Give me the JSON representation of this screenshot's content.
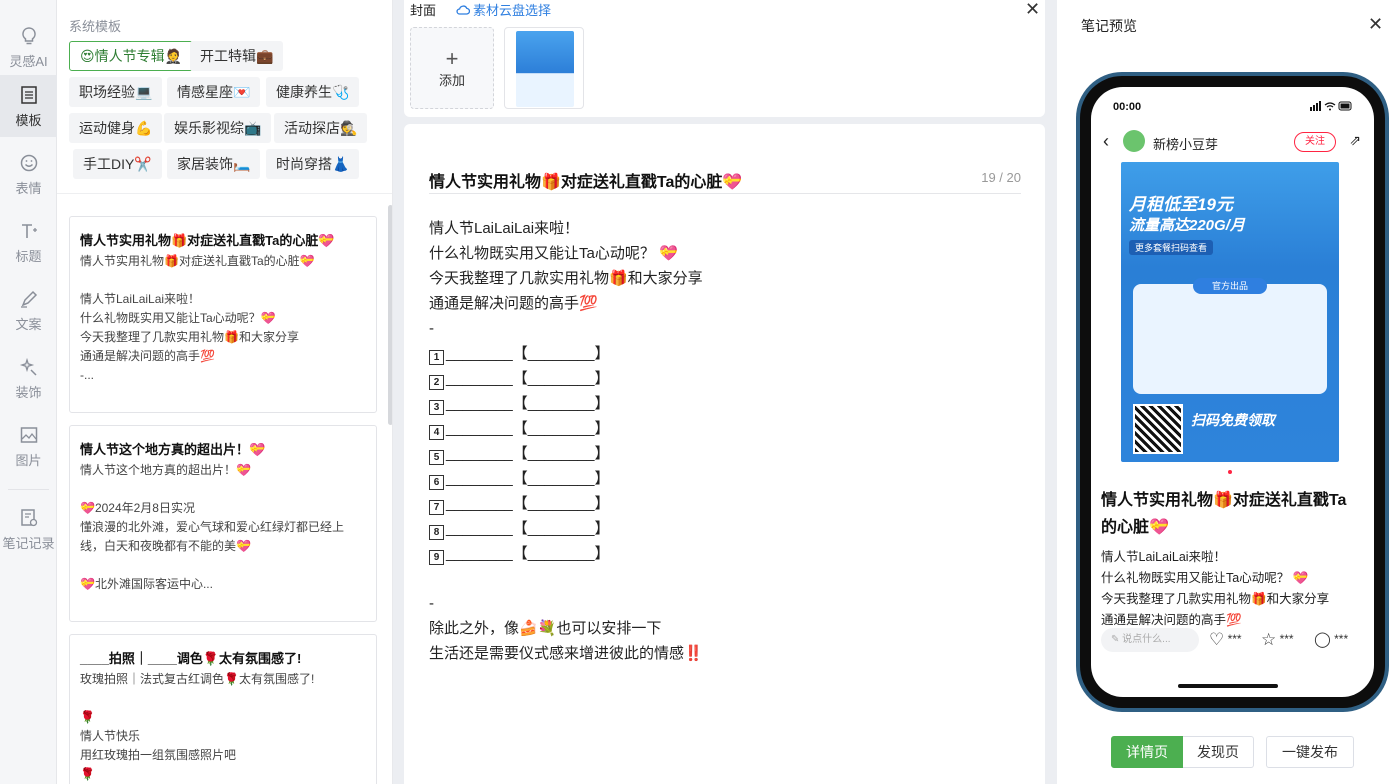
{
  "nav": [
    {
      "label": "灵感AI",
      "icon": "lightbulb-icon"
    },
    {
      "label": "模板",
      "icon": "template-icon",
      "active": true
    },
    {
      "label": "表情",
      "icon": "smiley-icon"
    },
    {
      "label": "标题",
      "icon": "title-icon"
    },
    {
      "label": "文案",
      "icon": "pen-icon"
    },
    {
      "label": "装饰",
      "icon": "sparkle-icon"
    },
    {
      "label": "图片",
      "icon": "image-icon"
    },
    {
      "label": "笔记记录",
      "icon": "note-record-icon"
    }
  ],
  "templates": {
    "section_title": "系统模板",
    "chips": [
      {
        "label": "😍情人节专辑🤵",
        "active": true
      },
      {
        "label": "开工特辑💼"
      },
      {
        "label": "职场经验💻"
      },
      {
        "label": "情感星座💌"
      },
      {
        "label": "健康养生🩺"
      },
      {
        "label": "运动健身💪"
      },
      {
        "label": "娱乐影视综📺"
      },
      {
        "label": "活动探店🕵️"
      },
      {
        "label": "手工DIY✂️"
      },
      {
        "label": "家居装饰🛏️"
      },
      {
        "label": "时尚穿搭👗"
      }
    ],
    "cards": [
      {
        "title": "情人节实用礼物🎁对症送礼直戳Ta的心脏💝",
        "lines": [
          "情人节实用礼物🎁对症送礼直戳Ta的心脏💝",
          "",
          "情人节LaiLaiLai来啦！",
          "什么礼物既实用又能让Ta心动呢？💝",
          "今天我整理了几款实用礼物🎁和大家分享",
          "通通是解决问题的高手💯",
          "-..."
        ]
      },
      {
        "title": "情人节这个地方真的超出片！💝",
        "lines": [
          "情人节这个地方真的超出片！💝",
          "",
          "💝2024年2月8日实况",
          "懂浪漫的北外滩，爱心气球和爱心红绿灯都已经上",
          "线，白天和夜晚都有不能的美💝",
          "",
          "💝北外滩国际客运中心..."
        ]
      },
      {
        "title": "____拍照｜____调色🌹太有氛围感了!",
        "lines": [
          "玫瑰拍照｜法式复古红调色🌹太有氛围感了!",
          "",
          "🌹",
          "情人节快乐",
          "用红玫瑰拍一组氛围感照片吧",
          "🌹"
        ]
      }
    ]
  },
  "cover": {
    "label": "封面",
    "cloud_link": "素材云盘选择",
    "add_label": "添加"
  },
  "editor": {
    "title": "情人节实用礼物🎁对症送礼直戳Ta的心脏💝",
    "count": "19 / 20",
    "lines": [
      "情人节LaiLaiLai来啦！",
      "什么礼物既实用又能让Ta心动呢？ 💝",
      "今天我整理了几款实用礼物🎁和大家分享",
      "通通是解决问题的高手💯",
      "-"
    ],
    "list_items": [
      {
        "num": "1",
        "text": "________【________】"
      },
      {
        "num": "2",
        "text": "________【________】"
      },
      {
        "num": "3",
        "text": "________【________】"
      },
      {
        "num": "4",
        "text": "________【________】"
      },
      {
        "num": "5",
        "text": "________【________】"
      },
      {
        "num": "6",
        "text": "________【________】"
      },
      {
        "num": "7",
        "text": "________【________】"
      },
      {
        "num": "8",
        "text": "________【________】"
      },
      {
        "num": "9",
        "text": "________【________】"
      }
    ],
    "tail_lines": [
      "",
      "-",
      "除此之外，像🍰💐也可以安排一下",
      "生活还是需要仪式感来增进彼此的情感‼️"
    ]
  },
  "preview": {
    "title": "笔记预览",
    "status_time": "00:00",
    "username": "新榜小豆芽",
    "follow_label": "关注",
    "image_headline_1": "月租低至19元",
    "image_headline_2": "流量高达220G/月",
    "image_button": "更多套餐扫码查看",
    "image_badge": "官方出品",
    "image_scan": "扫码免费领取",
    "note_title": "情人节实用礼物🎁对症送礼直戳Ta的心脏💝",
    "note_lines": [
      "情人节LaiLaiLai来啦！",
      "什么礼物既实用又能让Ta心动呢？ 💝",
      "今天我整理了几款实用礼物🎁和大家分享",
      "通通是解决问题的高手💯"
    ],
    "comment_placeholder": "说点什么...",
    "like_count": "***",
    "collect_count": "***",
    "comment_count": "***",
    "tabs": [
      {
        "label": "详情页",
        "active": true
      },
      {
        "label": "发现页"
      }
    ],
    "publish_label": "一键发布"
  },
  "colors": {
    "accent_green": "#4caf50",
    "link_blue": "#2f7fe0",
    "xhs_red": "#ff2442"
  }
}
